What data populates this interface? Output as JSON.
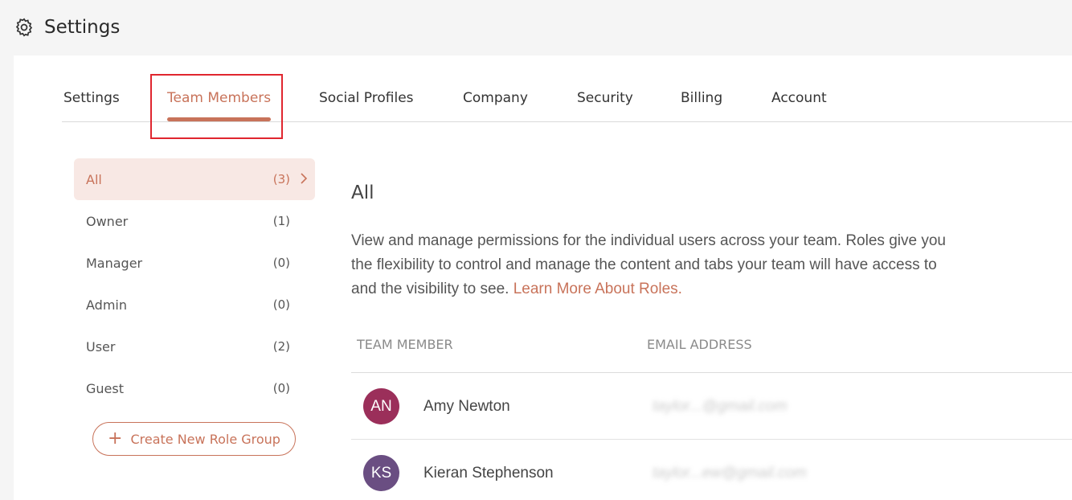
{
  "header": {
    "title": "Settings",
    "icon": "gear-icon"
  },
  "tabs": [
    {
      "label": "Settings",
      "active": false
    },
    {
      "label": "Team Members",
      "active": true
    },
    {
      "label": "Social Profiles",
      "active": false
    },
    {
      "label": "Company",
      "active": false
    },
    {
      "label": "Security",
      "active": false
    },
    {
      "label": "Billing",
      "active": false
    },
    {
      "label": "Account",
      "active": false
    }
  ],
  "roles": [
    {
      "label": "All",
      "count": "(3)",
      "active": true
    },
    {
      "label": "Owner",
      "count": "(1)"
    },
    {
      "label": "Manager",
      "count": "(0)"
    },
    {
      "label": "Admin",
      "count": "(0)"
    },
    {
      "label": "User",
      "count": "(2)"
    },
    {
      "label": "Guest",
      "count": "(0)"
    }
  ],
  "create_button": "Create New Role Group",
  "content": {
    "heading": "All",
    "description": "View and manage permissions for the individual users across your team. Roles give you the flexibility to control and manage the content and tabs your team will have access to and the visibility to see.",
    "link": "Learn More About Roles."
  },
  "table": {
    "headers": [
      "TEAM MEMBER",
      "EMAIL ADDRESS"
    ],
    "rows": [
      {
        "initials": "AN",
        "name": "Amy Newton",
        "email": "taylor...@gmail.com",
        "avatar_color": "#9b2f5a"
      },
      {
        "initials": "KS",
        "name": "Kieran Stephenson",
        "email": "taylor...ew@gmail.com",
        "avatar_color": "#6a4e82"
      }
    ]
  },
  "colors": {
    "accent": "#c8735a",
    "highlight_box": "#e0262f"
  }
}
